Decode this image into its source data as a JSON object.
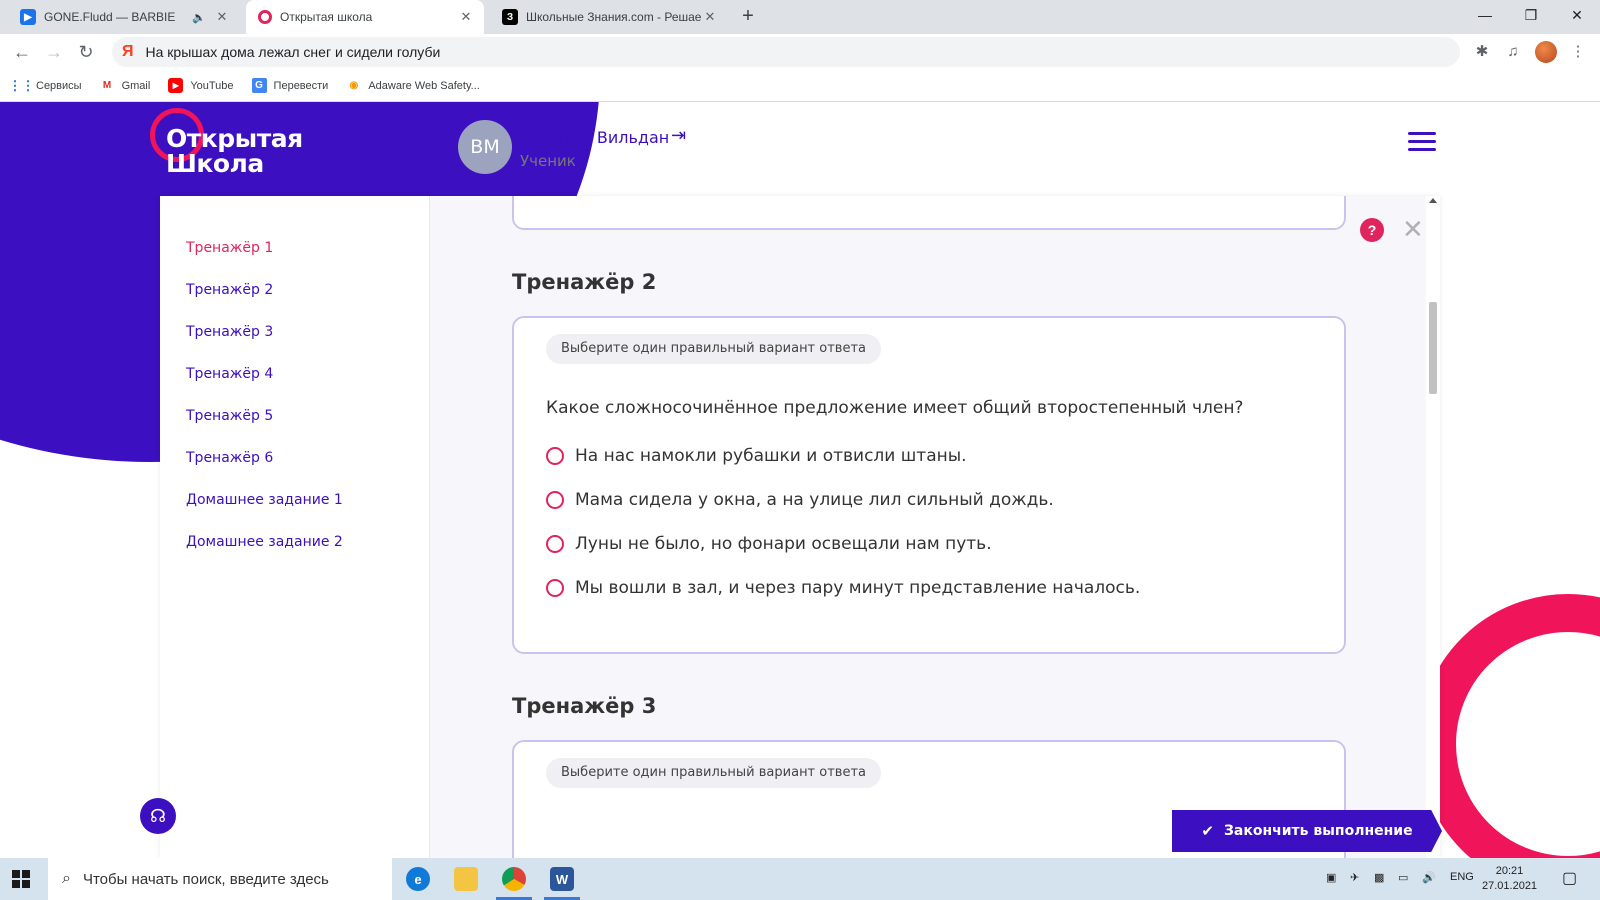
{
  "browser": {
    "tabs": [
      {
        "title": "GONE.Fludd — BARBIE",
        "favicon": "youtube-music-icon",
        "color": "#1a73e8"
      },
      {
        "title": "Открытая школа",
        "favicon": "open-school-icon",
        "color": "#e0245e"
      },
      {
        "title": "Школьные Знания.com - Решаем д",
        "favicon": "znanija-icon",
        "color": "#000000"
      }
    ],
    "address": "На крышах дома лежал снег и сидели голуби",
    "bookmarks": [
      {
        "label": "Сервисы",
        "icon": "apps-grid-icon"
      },
      {
        "label": "Gmail",
        "icon": "gmail-icon"
      },
      {
        "label": "YouTube",
        "icon": "youtube-icon"
      },
      {
        "label": "Перевести",
        "icon": "translate-icon"
      },
      {
        "label": "Adaware Web Safety...",
        "icon": "adaware-icon"
      }
    ]
  },
  "header": {
    "logo_line1": "Открытая",
    "logo_line2": "Школа",
    "user_initials": "ВМ",
    "user_name": "Муратов Вильдан",
    "user_role": "Ученик"
  },
  "sidebar": {
    "items": [
      {
        "label": "Тренажёр 1",
        "current": true
      },
      {
        "label": "Тренажёр 2"
      },
      {
        "label": "Тренажёр 3"
      },
      {
        "label": "Тренажёр 4"
      },
      {
        "label": "Тренажёр 5"
      },
      {
        "label": "Тренажёр 6"
      },
      {
        "label": "Домашнее задание 1"
      },
      {
        "label": "Домашнее задание 2"
      }
    ]
  },
  "main": {
    "section2": {
      "title": "Тренажёр 2",
      "hint": "Выберите один правильный вариант ответа",
      "question": "Какое сложносочинённое предложение имеет общий второстепенный член?",
      "options": [
        "На нас намокли рубашки и отвисли штаны.",
        "Мама сидела у окна, а на улице лил сильный дождь.",
        "Луны не было, но фонари освещали нам путь.",
        "Мы вошли в зал, и через пару минут представление началось."
      ]
    },
    "section3": {
      "title": "Тренажёр 3",
      "hint": "Выберите один правильный вариант ответа"
    },
    "finish_label": "Закончить выполнение",
    "help_label": "?"
  },
  "taskbar": {
    "search_placeholder": "Чтобы начать поиск, введите здесь",
    "lang": "ENG",
    "time": "20:21",
    "date": "27.01.2021"
  },
  "colors": {
    "brand_purple": "#3c0fc0",
    "brand_pink": "#e0245e"
  }
}
